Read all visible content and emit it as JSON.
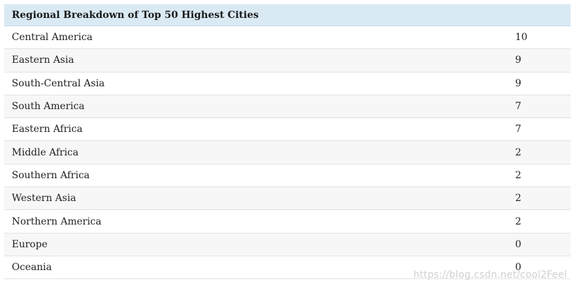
{
  "table": {
    "title": "Regional Breakdown of Top 50 Highest Cities",
    "rows": [
      {
        "region": "Central America",
        "count": "10"
      },
      {
        "region": "Eastern Asia",
        "count": "9"
      },
      {
        "region": "South-Central Asia",
        "count": "9"
      },
      {
        "region": "South America",
        "count": "7"
      },
      {
        "region": "Eastern Africa",
        "count": "7"
      },
      {
        "region": "Middle Africa",
        "count": "2"
      },
      {
        "region": "Southern Africa",
        "count": "2"
      },
      {
        "region": "Western Asia",
        "count": "2"
      },
      {
        "region": "Northern America",
        "count": "2"
      },
      {
        "region": "Europe",
        "count": "0"
      },
      {
        "region": "Oceania",
        "count": "0"
      }
    ]
  },
  "watermark": "https://blog.csdn.net/cool2Feel",
  "colors": {
    "header_bg": "#daeaf4",
    "row_alt_bg": "#f7f7f7"
  }
}
